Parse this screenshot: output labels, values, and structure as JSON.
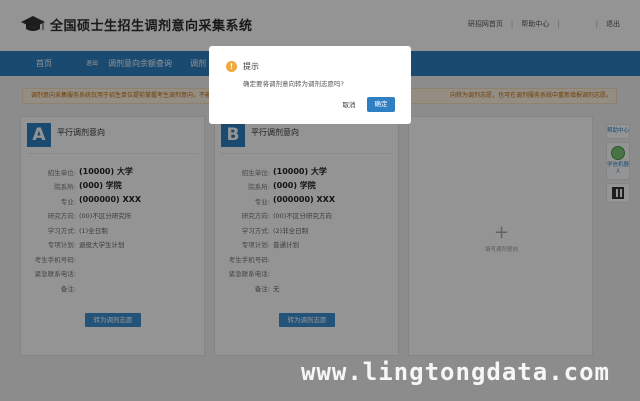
{
  "header": {
    "title": "全国硕士生招生调剂意向采集系统",
    "links": [
      "研招网首页",
      "帮助中心",
      "退出"
    ]
  },
  "nav": {
    "items": [
      "首页",
      "退出",
      "调剂意向余额查询",
      "调剂"
    ]
  },
  "notice": {
    "text": "调剂意向采集服务系统仅用于招生单位提前掌握考生调剂意向，不能替代调剂服务系统。考生在调剂服务系统中正式填报调剂志愿，",
    "text_right": "向转为调剂志愿，也可在调剂服务系统中重新填报调剂志愿。"
  },
  "cards": [
    {
      "badge": "A",
      "title": "平行调剂意向",
      "unit": "(10000) 大学",
      "dept": "(000) 学院",
      "major": "(000000) XXX",
      "direction": "(00)不区分研究所",
      "study_mode": "(1)全日制",
      "plan": "退役大学生计划",
      "phone": "",
      "emergency": "",
      "remark": "",
      "button": "转为调剂志愿"
    },
    {
      "badge": "B",
      "title": "平行调剂意向",
      "unit": "(10000) 大学",
      "dept": "(000) 学院",
      "major": "(000000) XXX",
      "direction": "(00)不区分研究方向",
      "study_mode": "(2)非全日制",
      "plan": "普通计划",
      "phone": "",
      "emergency": "",
      "remark": "无",
      "button": "转为调剂志愿"
    }
  ],
  "labels": {
    "unit": "招生单位:",
    "dept": "院系所:",
    "major": "专业:",
    "direction": "研究方向:",
    "study_mode": "学习方式:",
    "plan": "专项计划:",
    "phone": "考生手机号码:",
    "emergency": "紧急联系电话:",
    "remark": "备注:"
  },
  "add_card": {
    "label": "填写调剂意向"
  },
  "side": {
    "help": "帮助中心",
    "robot": "学信机器人"
  },
  "modal": {
    "title": "提示",
    "message": "确定要将调剂意向转为调剂志愿吗?",
    "cancel": "取消",
    "confirm": "确定"
  },
  "watermark": "www.lingtongdata.com"
}
